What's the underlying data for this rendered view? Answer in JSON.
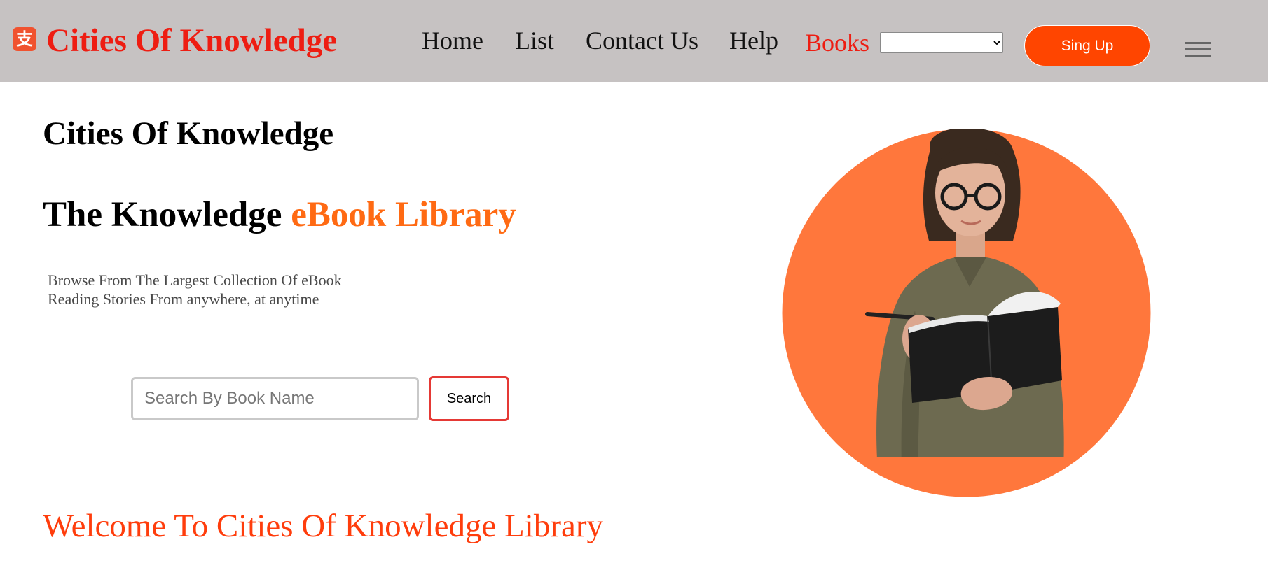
{
  "header": {
    "logo_icon": "alipay-logo-icon",
    "logo_glyph": "支",
    "brand": "Cities Of Knowledge",
    "nav": [
      {
        "label": "Home"
      },
      {
        "label": "List"
      },
      {
        "label": "Contact Us"
      },
      {
        "label": "Help"
      },
      {
        "label": "Books"
      }
    ],
    "books_select_value": "",
    "signup_label": "Sing Up",
    "menu_icon": "hamburger-menu-icon"
  },
  "hero": {
    "site_title": "Cities Of Knowledge",
    "heading_main": "The Knowledge ",
    "heading_accent": "eBook Library",
    "description": "Browse From The Largest Collection Of eBook Reading Stories From anywhere, at anytime",
    "search": {
      "placeholder": "Search By Book Name",
      "value": "",
      "button_label": "Search"
    },
    "image": "woman-reading-book-illustration"
  },
  "welcome_text": "Welcome To Cities Of Knowledge Library",
  "colors": {
    "header_bg": "#c6c2c2",
    "brand_red": "#ee1d12",
    "accent_orange": "#ff6a13",
    "signup_bg": "#ff4500",
    "circle_orange": "#ff773c",
    "search_border": "#e53935"
  }
}
